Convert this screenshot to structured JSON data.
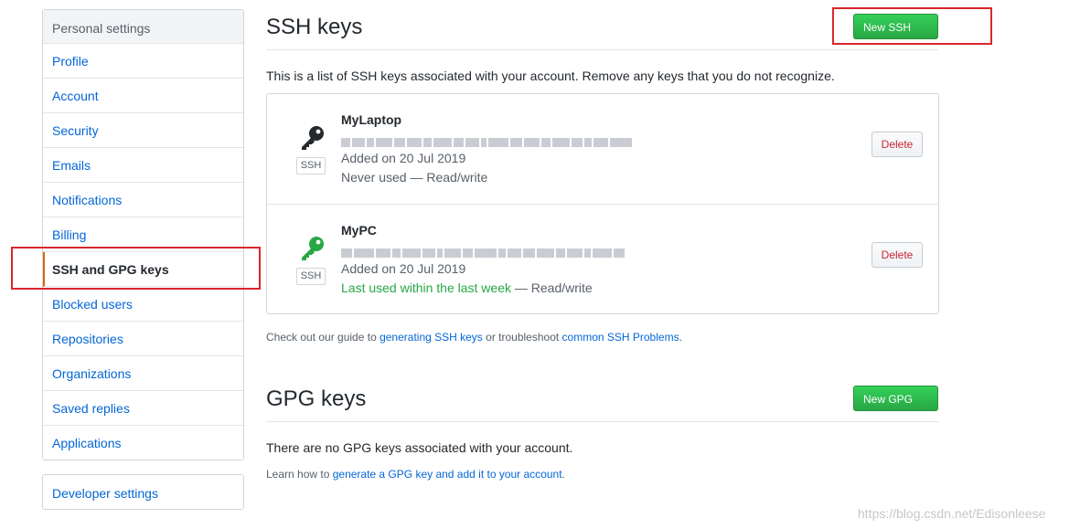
{
  "sidebar": {
    "header": "Personal settings",
    "items": [
      {
        "label": "Profile"
      },
      {
        "label": "Account"
      },
      {
        "label": "Security"
      },
      {
        "label": "Emails"
      },
      {
        "label": "Notifications"
      },
      {
        "label": "Billing"
      },
      {
        "label": "SSH and GPG keys",
        "selected": true
      },
      {
        "label": "Blocked users"
      },
      {
        "label": "Repositories"
      },
      {
        "label": "Organizations"
      },
      {
        "label": "Saved replies"
      },
      {
        "label": "Applications"
      }
    ],
    "developer_settings": "Developer settings"
  },
  "ssh": {
    "title": "SSH keys",
    "new_button": "New SSH key",
    "description": "This is a list of SSH keys associated with your account. Remove any keys that you do not recognize.",
    "keys": [
      {
        "name": "MyLaptop",
        "type_label": "SSH",
        "added": "Added on 20 Jul 2019",
        "usage": "Never used",
        "access": " — Read/write",
        "icon": "key-icon-black",
        "icon_color": "#24292e",
        "delete_label": "Delete"
      },
      {
        "name": "MyPC",
        "type_label": "SSH",
        "added": "Added on 20 Jul 2019",
        "usage": "Last used within the last week",
        "access": " — Read/write",
        "icon": "key-icon-green",
        "icon_color": "#28a745",
        "delete_label": "Delete"
      }
    ],
    "guide_prefix": "Check out our guide to ",
    "guide_link": "generating SSH keys",
    "guide_middle": " or troubleshoot ",
    "guide_link2": "common SSH Problems",
    "guide_suffix": "."
  },
  "gpg": {
    "title": "GPG keys",
    "new_button": "New GPG key",
    "empty_text": "There are no GPG keys associated with your account.",
    "learn_prefix": "Learn how to ",
    "learn_link": "generate a GPG key and add it to your account",
    "learn_suffix": "."
  },
  "watermark": "https://blog.csdn.net/Edisonleese",
  "colors": {
    "link": "#0366d6",
    "green_button": "#28a745",
    "delete_text": "#cb2431",
    "selected_border": "#e36209",
    "highlight_box": "#d9262c"
  }
}
